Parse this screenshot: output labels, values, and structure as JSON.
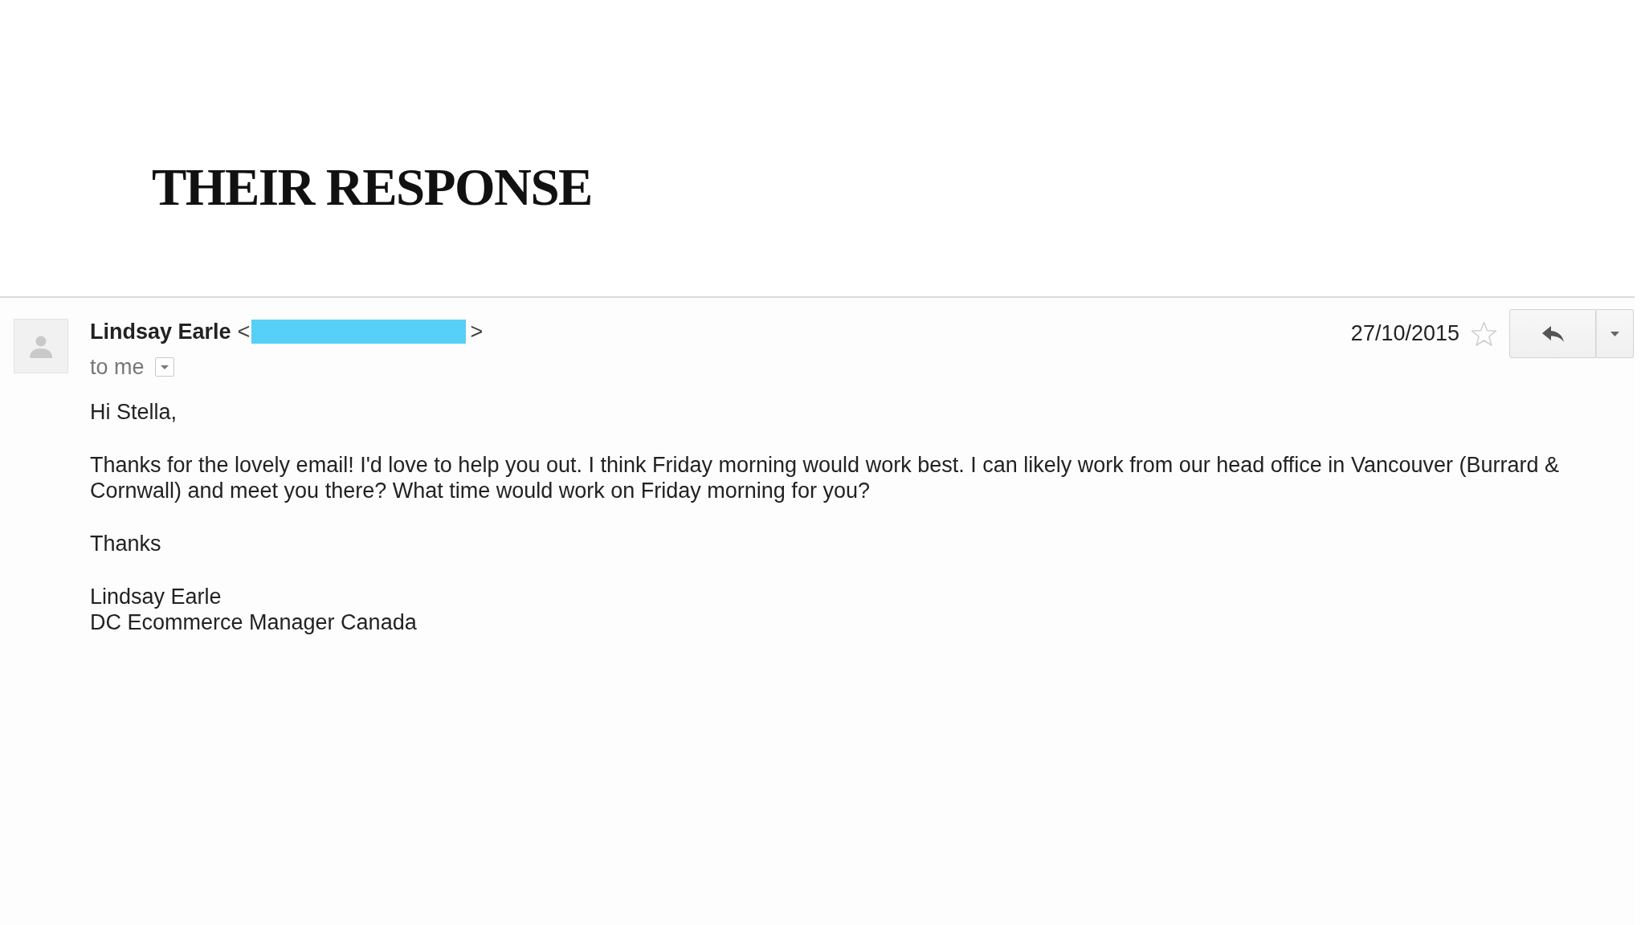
{
  "title": "THEIR RESPONSE",
  "email": {
    "sender": {
      "name": "Lindsay Earle",
      "address_open": "<",
      "address_redacted": true,
      "address_close": ">"
    },
    "recipient": "to me",
    "date": "27/10/2015",
    "starred": false,
    "body": [
      "Hi Stella,",
      "Thanks for the lovely email! I'd love to help you out. I think Friday morning would work best. I can likely work from our head office in Vancouver (Burrard & Cornwall) and meet you there? What time would work on Friday morning for you?",
      "Thanks"
    ],
    "signature": [
      "Lindsay Earle",
      "DC Ecommerce Manager Canada"
    ]
  }
}
